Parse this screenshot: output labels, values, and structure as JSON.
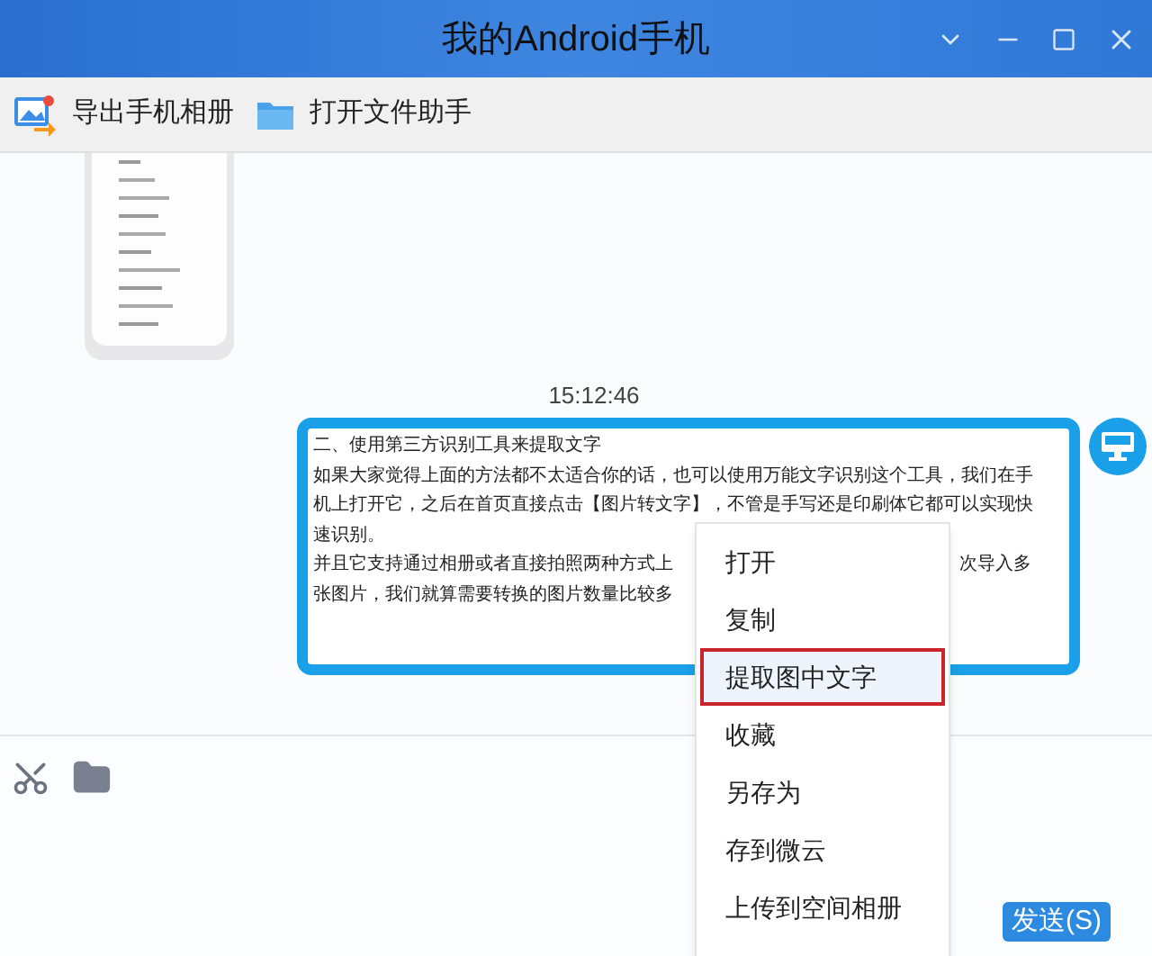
{
  "window": {
    "title": "我的Android手机"
  },
  "toolbar": [
    {
      "kind": "export",
      "label": "导出手机相册"
    },
    {
      "kind": "folder",
      "label": "打开文件助手"
    }
  ],
  "chat": {
    "timestamp": "15:12:46",
    "message_lines": [
      {
        "text": "二、使用第三方识别工具来提取文字"
      },
      {
        "text": "如果大家觉得上面的方法都不太适合你的话，也可以使用万能文字识别这个工具，我们在手"
      },
      {
        "text": "机上打开它，之后在首页直接点击【图片转文字】，不管是手写还是印刷体它都可以实现快"
      },
      {
        "text": "速识别。"
      },
      {
        "text": "并且它支持通过相册或者直接拍照两种方式上",
        "tail": "次导入多"
      },
      {
        "text": "张图片，我们就算需要转换的图片数量比较多"
      }
    ]
  },
  "context_menu": [
    {
      "label": "打开",
      "selected": false
    },
    {
      "label": "复制",
      "selected": false
    },
    {
      "label": "提取图中文字",
      "selected": true
    },
    {
      "label": "收藏",
      "selected": false
    },
    {
      "label": "另存为",
      "selected": false
    },
    {
      "label": "存到微云",
      "selected": false
    },
    {
      "label": "上传到空间相册",
      "selected": false
    }
  ],
  "input_tools": [
    {
      "kind": "scissors"
    },
    {
      "kind": "folder"
    }
  ],
  "send_button": "发送(S)"
}
